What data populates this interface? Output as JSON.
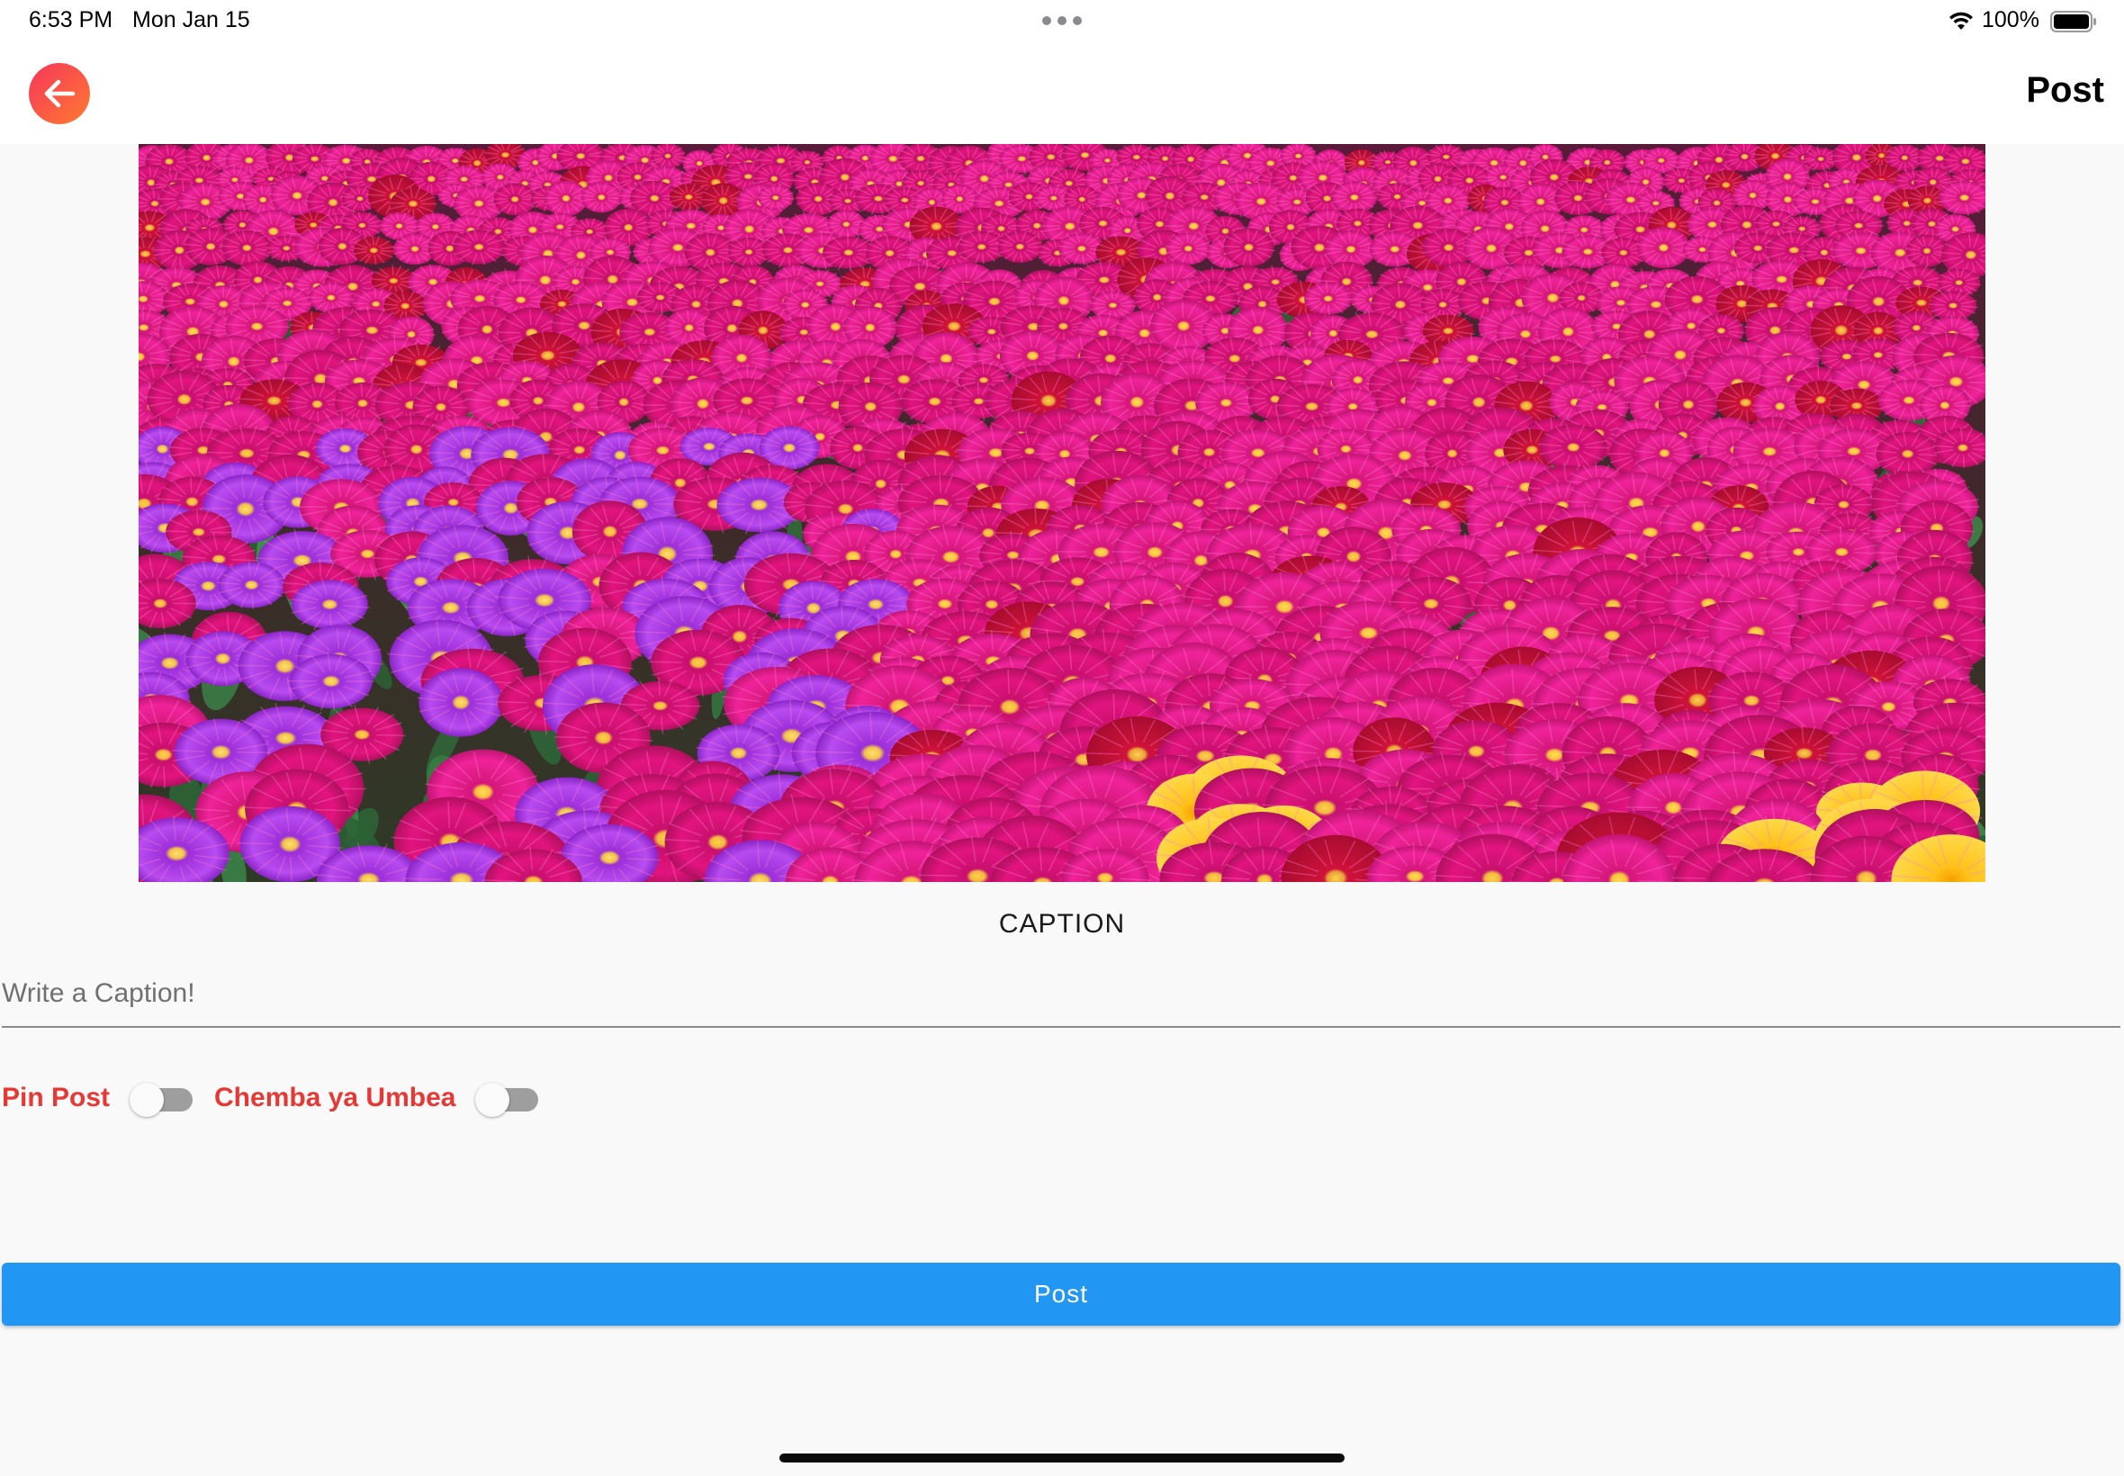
{
  "status_bar": {
    "time": "6:53 PM",
    "date": "Mon Jan 15",
    "battery_percent": "100%",
    "icons": [
      "multitasking-dots-icon",
      "wifi-icon",
      "battery-icon"
    ]
  },
  "nav": {
    "title": "Post",
    "back_icon": "arrow-left-icon"
  },
  "image": {
    "description_icon": "flower-field-photo"
  },
  "caption": {
    "heading": "CAPTION",
    "placeholder": "Write a Caption!",
    "value": ""
  },
  "toggles": [
    {
      "label": "Pin Post",
      "on": false
    },
    {
      "label": "Chemba ya Umbea",
      "on": false
    }
  ],
  "post_button": {
    "label": "Post"
  },
  "colors": {
    "accent_blue": "#2196f3",
    "toggle_label_red": "#e53935",
    "back_button_gradient_start": "#f5365c",
    "back_button_gradient_end": "#ff7a2f",
    "background": "#f9f9f9"
  }
}
